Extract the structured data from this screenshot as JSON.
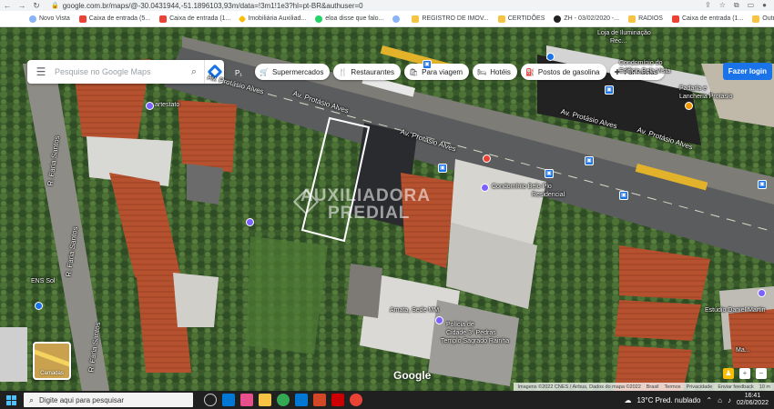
{
  "browser": {
    "url": "google.com.br/maps/@-30.0431944,-51.1896103,93m/data=!3m1!1e3?hl=pt-BR&authuser=0",
    "bookmarks": [
      {
        "label": "Novo Vista",
        "icon": "web"
      },
      {
        "label": "Caixa de entrada (5...",
        "icon": "gmail"
      },
      {
        "label": "Caixa de entrada (1...",
        "icon": "gmail"
      },
      {
        "label": "Imobiliária Auxiliad...",
        "icon": "imob"
      },
      {
        "label": "eloa disse que falo...",
        "icon": "wa"
      },
      {
        "label": "",
        "icon": "web"
      },
      {
        "label": "REGISTRO DE IMOV...",
        "icon": "folder"
      },
      {
        "label": "CERTIDÕES",
        "icon": "folder"
      },
      {
        "label": "ZH - 03/02/2020 -...",
        "icon": "zh"
      },
      {
        "label": "RADIOS",
        "icon": "folder"
      },
      {
        "label": "Caixa de entrada (1...",
        "icon": "gmail"
      },
      {
        "label": "Outros fa",
        "icon": "folder"
      }
    ]
  },
  "maps": {
    "search_placeholder": "Pesquise no Google Maps",
    "pegman_label": "P₁",
    "chips": [
      {
        "label": "Supermercados",
        "icon": "🛒"
      },
      {
        "label": "Restaurantes",
        "icon": "🍴"
      },
      {
        "label": "Para viagem",
        "icon": "🛍"
      },
      {
        "label": "Hotéis",
        "icon": "🛏"
      },
      {
        "label": "Postos de gasolina",
        "icon": "⛽"
      },
      {
        "label": "Farmácias",
        "icon": "✚"
      }
    ],
    "login_label": "Fazer login",
    "labels": {
      "street_1": "Av. Protásio Alves",
      "street_2": "Av. Protásio Alves",
      "street_3": "Av. Protásio Alves",
      "street_4": "Av. Protásio Alves",
      "street_5": "Av. Protásio Alves",
      "rua_faria_1": "R. Faria Santos",
      "rua_faria_2": "R. Faria Santos",
      "rua_faria_3": "R. Faria Santos",
      "poi_artestato": "artestato",
      "poi_loja_1": "Loja de Iluminação",
      "poi_loja_2": "Rec...",
      "poi_condominio_1": "Condomínio do",
      "poi_condominio_2": "Edifício Bela Vista",
      "poi_padaria_1": "Padaria e",
      "poi_padaria_2": "Lancheria Protásio",
      "poi_centro_1": "Condomínio Belo Plo",
      "poi_centro_2": "Residencial",
      "poi_ens": "ENS Sol",
      "poi_amata_1": "Amata, Sede MM",
      "poi_policia_1": "Polícia de",
      "poi_policia_2": "Cidade 3ª Pedras",
      "poi_policia_3": "Templo Sagrado Rainha",
      "poi_estudio_1": "Estúdio Daniel Martin",
      "poi_map_1": "Ma..."
    },
    "watermark_1": "AUXILIADORA",
    "watermark_2": "PREDIAL",
    "layers_label": "Camadas",
    "google_logo": "Google",
    "attribution": [
      "Imagens ©2022 CNES / Airbus, Dados do mapa ©2022",
      "Brasil",
      "Termos",
      "Privacidade",
      "Enviar feedback",
      "10 m"
    ]
  },
  "taskbar": {
    "search_placeholder": "Digite aqui para pesquisar",
    "weather": "13°C Pred. nublado",
    "time": "16:41",
    "date": "02/06/2022"
  }
}
